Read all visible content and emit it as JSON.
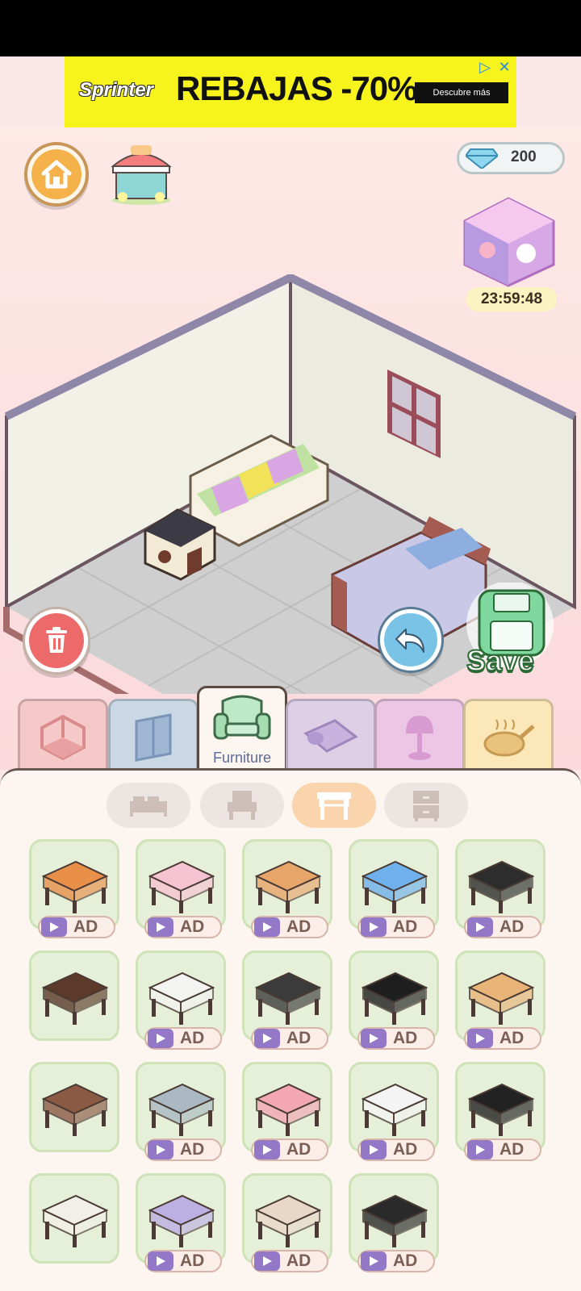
{
  "ad_banner": {
    "brand": "Sprinter",
    "headline": "REBAJAS -70%",
    "cta": "Descubre más",
    "ad_choices_icon": "ad-choices-icon",
    "close_icon": "close-icon"
  },
  "hud": {
    "gems": "200",
    "timer": "23:59:48",
    "save_label": "Save"
  },
  "categories": [
    {
      "name": "room-layout",
      "color": "#f4c9c8",
      "label": ""
    },
    {
      "name": "doors-windows",
      "color": "#c9d8e4",
      "label": ""
    },
    {
      "name": "furniture",
      "color": "#fdf5ef",
      "label": "Furniture",
      "active": true
    },
    {
      "name": "rugs",
      "color": "#dccfe6",
      "label": ""
    },
    {
      "name": "lamps",
      "color": "#ecc6e4",
      "label": ""
    },
    {
      "name": "kitchen",
      "color": "#fbe7b7",
      "label": ""
    }
  ],
  "subcategories": [
    "beds",
    "chairs",
    "tables",
    "cabinets"
  ],
  "active_subcategory": "tables",
  "ad_label": "AD",
  "items": [
    {
      "name": "wood-side-table",
      "ad": true,
      "color": "#e88f4a"
    },
    {
      "name": "pink-coffee-table",
      "ad": true,
      "color": "#f6c3d3"
    },
    {
      "name": "keyboard-desk",
      "ad": true,
      "color": "#e8a56a"
    },
    {
      "name": "blue-tile-table",
      "ad": true,
      "color": "#6fb1ec"
    },
    {
      "name": "black-l-desk",
      "ad": true,
      "color": "#2d2d2d"
    },
    {
      "name": "dark-wood-table",
      "ad": false,
      "color": "#5b3a2a"
    },
    {
      "name": "white-marble-table",
      "ad": true,
      "color": "#f3f3f1"
    },
    {
      "name": "drafting-desk",
      "ad": true,
      "color": "#3b3b3b"
    },
    {
      "name": "black-marble-counter",
      "ad": true,
      "color": "#1f1f1f"
    },
    {
      "name": "beige-study-desk",
      "ad": true,
      "color": "#e9b477"
    },
    {
      "name": "small-brown-stool",
      "ad": false,
      "color": "#8b5a45"
    },
    {
      "name": "glass-round-table",
      "ad": true,
      "color": "#aab9c2"
    },
    {
      "name": "pink-oval-table",
      "ad": true,
      "color": "#f2a7b3"
    },
    {
      "name": "white-orange-desk",
      "ad": true,
      "color": "#f4f4f4"
    },
    {
      "name": "black-white-l-desk",
      "ad": true,
      "color": "#222222"
    },
    {
      "name": "white-slim-table",
      "ad": false,
      "color": "#f2efe8"
    },
    {
      "name": "lavender-cloth-table",
      "ad": true,
      "color": "#bcb0e3"
    },
    {
      "name": "cream-writing-desk",
      "ad": true,
      "color": "#e9d8c8"
    },
    {
      "name": "black-executive-desk",
      "ad": true,
      "color": "#2a2a2a"
    }
  ]
}
